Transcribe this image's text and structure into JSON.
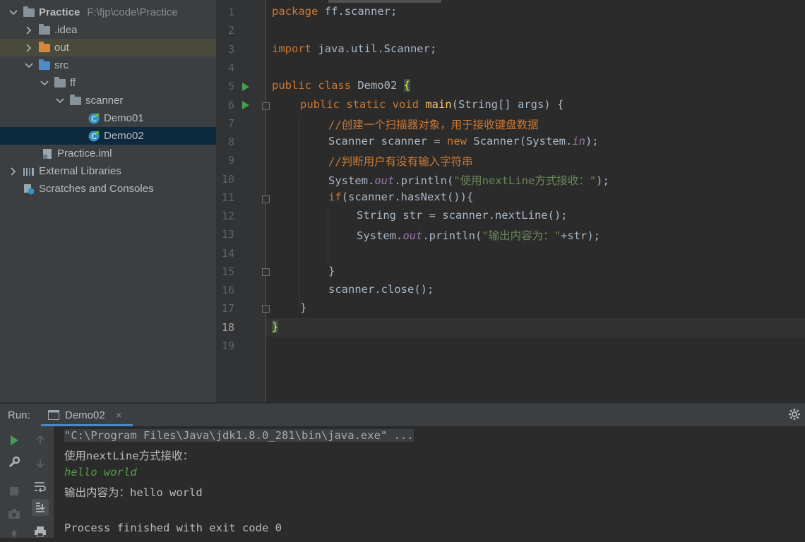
{
  "project_tree": {
    "root": {
      "name": "Practice",
      "path": "F:\\fjp\\code\\Practice"
    },
    "items": [
      {
        "label": ".idea"
      },
      {
        "label": "out"
      },
      {
        "label": "src"
      },
      {
        "label": "ff"
      },
      {
        "label": "scanner"
      },
      {
        "label": "Demo01"
      },
      {
        "label": "Demo02"
      },
      {
        "label": "Practice.iml"
      },
      {
        "label": "External Libraries"
      },
      {
        "label": "Scratches and Consoles"
      }
    ]
  },
  "editor": {
    "line_numbers": [
      "1",
      "2",
      "3",
      "4",
      "5",
      "6",
      "7",
      "8",
      "9",
      "10",
      "11",
      "12",
      "13",
      "14",
      "15",
      "16",
      "17",
      "18",
      "19"
    ],
    "current_line": "18",
    "lines": {
      "l1_kw": "package",
      "l1_rest": " ff.scanner;",
      "l3_kw": "import",
      "l3_rest": " java.util.Scanner;",
      "l5_kw": "public class",
      "l5_name": " Demo02 ",
      "l5_brace": "{",
      "l6_kw": "public static void",
      "l6_fn": "main",
      "l6_rest": "(String[] args) {",
      "l7_comment": "//创建一个扫描器对象，用于接收键盘数据",
      "l8_a": "Scanner scanner = ",
      "l8_kw": "new",
      "l8_b": " Scanner(System.",
      "l8_st": "in",
      "l8_c": ");",
      "l9_comment": "//判断用户有没有输入字符串",
      "l10_a": "System.",
      "l10_st": "out",
      "l10_b": ".println(",
      "l10_str": "\"使用nextLine方式接收：\"",
      "l10_c": ");",
      "l11_kw": "if",
      "l11_rest": "(scanner.hasNext()){",
      "l12_text": "String str = scanner.nextLine();",
      "l13_a": "System.",
      "l13_st": "out",
      "l13_b": ".println(",
      "l13_str": "\"输出内容为：\"",
      "l13_c": "+str);",
      "l15_text": "}",
      "l16_text": "scanner.close();",
      "l17_text": "}",
      "l18_text": "}"
    }
  },
  "run_panel": {
    "label": "Run:",
    "tab_label": "Demo02",
    "tab_close": "×",
    "console": {
      "command": "\"C:\\Program Files\\Java\\jdk1.8.0_281\\bin\\java.exe\" ...",
      "out1": "使用nextLine方式接收：",
      "input": "hello world",
      "out2": "输出内容为：hello world",
      "finish": "Process finished with exit code 0"
    }
  },
  "icons": {
    "gear": "gear-icon",
    "run": "run-icon",
    "wrench": "wrench-icon",
    "stop": "stop-icon",
    "camera": "camera-icon",
    "up": "up-arrow-icon",
    "down": "down-arrow-icon",
    "soft_wrap": "soft-wrap-icon",
    "scroll_end": "scroll-to-end-icon",
    "print": "print-icon"
  },
  "colors": {
    "keyword": "#cc7832",
    "string": "#6a8759",
    "static_field": "#9876aa",
    "function": "#ffc66d",
    "selection": "#0d293e",
    "run_green": "#499c54",
    "tab_underline": "#4a88c7"
  }
}
